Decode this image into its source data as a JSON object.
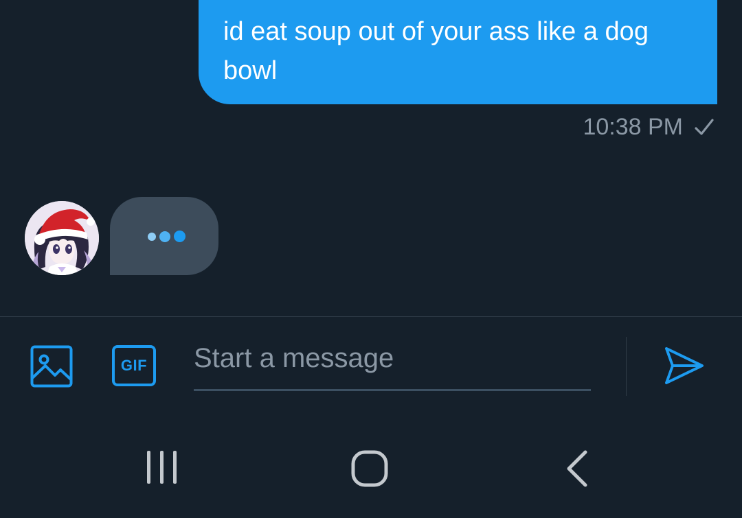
{
  "conversation": {
    "sent_message": {
      "text": "id eat soup out of your ass like a dog bowl",
      "timestamp": "10:38 PM",
      "status_icon": "checkmark-icon"
    },
    "typing_indicator": {
      "avatar": "avatar-santa-hat",
      "dots": 3
    }
  },
  "composer": {
    "media_icon": "image-icon",
    "gif_label": "GIF",
    "placeholder": "Start a message",
    "value": "",
    "send_icon": "send-icon"
  },
  "navbar": {
    "recents_icon": "recent-apps-icon",
    "home_icon": "home-icon",
    "back_icon": "back-icon"
  },
  "colors": {
    "background": "#15202b",
    "accent": "#1d9bf0",
    "typing_bubble": "#3d4c5b",
    "secondary_text": "#8b98a5",
    "navbar_icon": "#c4c9ce"
  }
}
